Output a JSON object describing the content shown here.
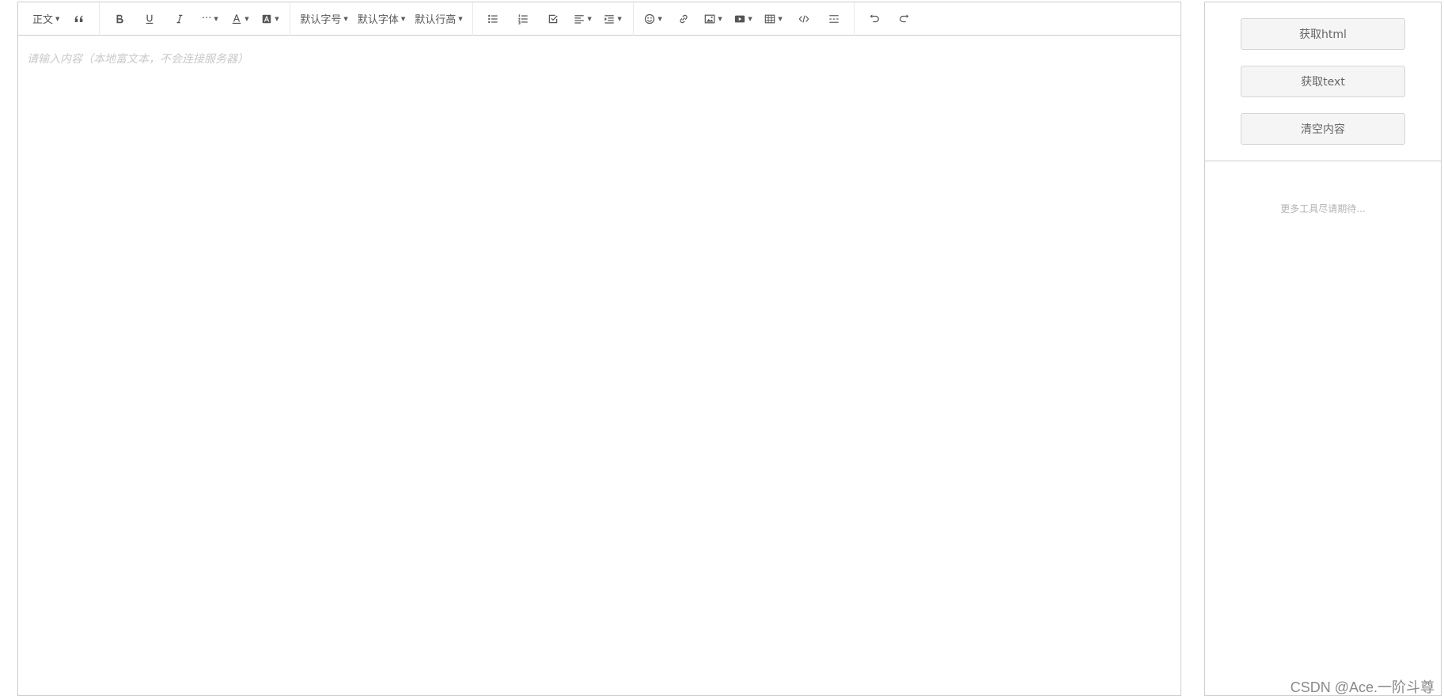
{
  "toolbar": {
    "heading": "正文",
    "font_size": "默认字号",
    "font_family": "默认字体",
    "line_height": "默认行高",
    "icons": [
      "blockquote-icon",
      "bold-icon",
      "underline-icon",
      "italic-icon",
      "more-icon",
      "font-color-icon",
      "background-color-icon",
      "bulleted-list-icon",
      "numbered-list-icon",
      "todo-icon",
      "align-icon",
      "indent-icon",
      "emotion-icon",
      "link-icon",
      "image-icon",
      "video-icon",
      "table-icon",
      "code-block-icon",
      "divider-icon",
      "undo-icon",
      "redo-icon"
    ]
  },
  "editor": {
    "placeholder": "请输入内容（本地富文本，不会连接服务器）"
  },
  "side_panel": {
    "buttons": [
      "获取html",
      "获取text",
      "清空内容"
    ],
    "note": "更多工具尽请期待..."
  },
  "watermark": "CSDN @Ace.一阶斗尊"
}
